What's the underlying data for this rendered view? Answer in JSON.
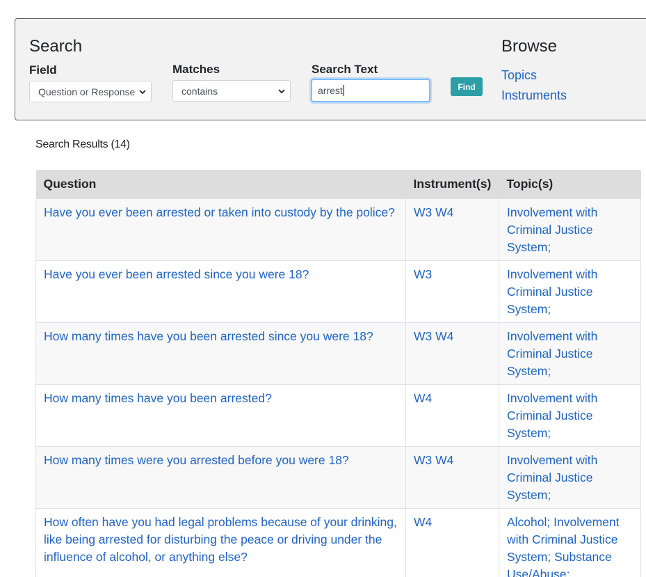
{
  "search": {
    "title": "Search",
    "field_label": "Field",
    "field_value": "Question or Response",
    "matches_label": "Matches",
    "matches_value": "contains",
    "text_label": "Search Text",
    "text_value": "arrest",
    "find_label": "Find"
  },
  "browse": {
    "title": "Browse",
    "links": [
      "Topics",
      "Instruments"
    ]
  },
  "results": {
    "heading": "Search Results (14)",
    "columns": [
      "Question",
      "Instrument(s)",
      "Topic(s)"
    ],
    "rows": [
      {
        "question": "Have you ever been arrested or taken into custody by the police?",
        "instruments": "W3 W4",
        "topics": "Involvement with Criminal Justice System;"
      },
      {
        "question": "Have you ever been arrested since you were 18?",
        "instruments": "W3",
        "topics": "Involvement with Criminal Justice System;"
      },
      {
        "question": "How many times have you been arrested since you were 18?",
        "instruments": "W3 W4",
        "topics": "Involvement with Criminal Justice System;"
      },
      {
        "question": "How many times have you been arrested?",
        "instruments": "W4",
        "topics": "Involvement with Criminal Justice System;"
      },
      {
        "question": "How many times were you arrested before you were 18?",
        "instruments": "W3 W4",
        "topics": "Involvement with Criminal Justice System;"
      },
      {
        "question": "How often have you had legal problems because of your drinking, like being arrested for disturbing the peace or driving under the influence of alcohol, or anything else?",
        "instruments": "W4",
        "topics": "Alcohol; Involvement with Criminal Justice System; Substance Use/Abuse;"
      }
    ]
  },
  "colors": {
    "link": "#1d64c4",
    "find_button": "#2b9ea6",
    "panel_bg": "#f2f2f2",
    "header_bg": "#dddddd",
    "input_focus": "#80bdff"
  },
  "icons": {
    "select_chevron": "chevron-down-icon"
  }
}
